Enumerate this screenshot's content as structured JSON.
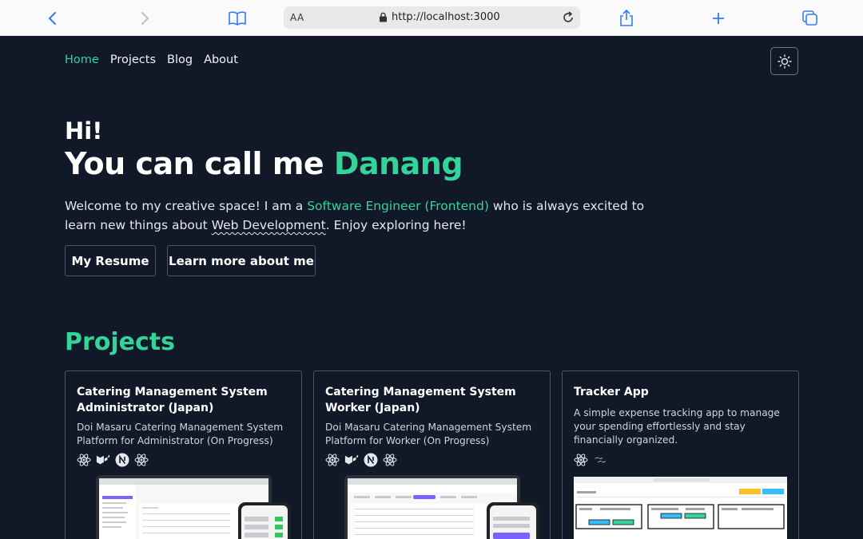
{
  "browser": {
    "reader_label": "AA",
    "url": "http://localhost:3000"
  },
  "nav": {
    "items": [
      {
        "label": "Home",
        "active": true
      },
      {
        "label": "Projects",
        "active": false
      },
      {
        "label": "Blog",
        "active": false
      },
      {
        "label": "About",
        "active": false
      }
    ]
  },
  "hero": {
    "greeting": "Hi!",
    "headline_prefix": "You can call me ",
    "name": "Danang",
    "intro_part1": "Welcome to my creative space! I am a ",
    "role": "Software Engineer (Frontend)",
    "intro_part2": " who is always excited to learn new things about ",
    "topic": "Web Development",
    "intro_part3": ". Enjoy exploring here!",
    "resume_label": "My Resume",
    "about_label": "Learn more about me"
  },
  "projects": {
    "title": "Projects",
    "cards": [
      {
        "title": "Catering Management System Administrator (Japan)",
        "description": "Doi Masaru Catering Management System Platform for Administrator (On Progress)",
        "icons": [
          "react-icon",
          "mui-icon",
          "nextjs-icon",
          "react-icon"
        ]
      },
      {
        "title": "Catering Management System Worker (Japan)",
        "description": "Doi Masaru Catering Management System Platform for Worker (On Progress)",
        "icons": [
          "react-icon",
          "mui-icon",
          "nextjs-icon",
          "react-icon"
        ]
      },
      {
        "title": "Tracker App",
        "description": "A simple expense tracking app to manage your spending effortlessly and stay financially organized.",
        "icons": [
          "react-icon",
          "tailwind-icon"
        ]
      }
    ]
  },
  "colors": {
    "accent": "#34d399",
    "background": "#111827"
  }
}
